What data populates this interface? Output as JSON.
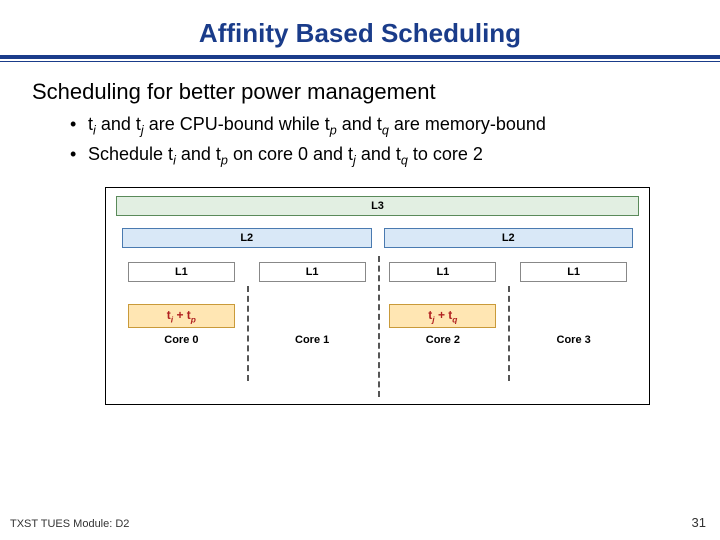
{
  "title": "Affinity Based Scheduling",
  "subtitle": "Scheduling for better power management",
  "bullets": [
    {
      "prefix": "t",
      "s1": "i",
      "mid1": " and t",
      "s2": "j",
      "mid2": " are CPU-bound while t",
      "s3": "p",
      "mid3": " and t",
      "s4": "q",
      "suffix": " are memory-bound"
    },
    {
      "prefix": "Schedule t",
      "s1": "i",
      "mid1": " and t",
      "s2": "p",
      "mid2": " on core 0 and t",
      "s3": "j",
      "mid3": " and t",
      "s4": "q",
      "suffix": " to core 2"
    }
  ],
  "diagram": {
    "l3": "L3",
    "l2_left": "L2",
    "l2_right": "L2",
    "l1": "L1",
    "cores": [
      "Core 0",
      "Core 1",
      "Core 2",
      "Core 3"
    ],
    "task_left_a": "t",
    "task_left_as": "i",
    "task_left_plus": " + t",
    "task_left_bs": "p",
    "task_right_a": "t",
    "task_right_as": "j",
    "task_right_plus": " + t",
    "task_right_bs": "q"
  },
  "footer": {
    "left": "TXST TUES Module: D2",
    "page": "31"
  }
}
